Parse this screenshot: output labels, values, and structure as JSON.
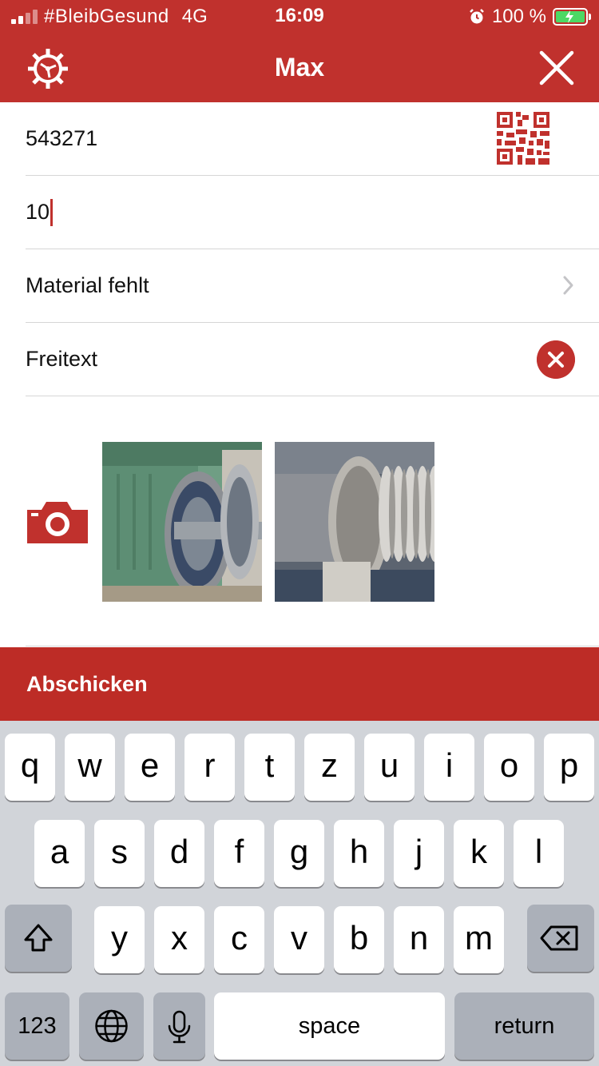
{
  "status_bar": {
    "carrier": "#BleibGesund",
    "network": "4G",
    "time": "16:09",
    "battery": "100 %"
  },
  "header": {
    "title": "Max"
  },
  "form": {
    "field_1_value": "543271",
    "field_2_value": "10",
    "field_3_value": "Material fehlt",
    "field_4_value": "Freitext"
  },
  "photos": {
    "count": 2
  },
  "submit_label": "Abschicken",
  "keyboard": {
    "row1": [
      "q",
      "w",
      "e",
      "r",
      "t",
      "z",
      "u",
      "i",
      "o",
      "p"
    ],
    "row2": [
      "a",
      "s",
      "d",
      "f",
      "g",
      "h",
      "j",
      "k",
      "l"
    ],
    "row3": [
      "y",
      "x",
      "c",
      "v",
      "b",
      "n",
      "m"
    ],
    "numbers_label": "123",
    "space_label": "space",
    "return_label": "return"
  },
  "colors": {
    "brand_red": "#c0312d",
    "keyboard_bg": "#d1d4d9"
  },
  "icons": [
    "gear-icon",
    "close-icon",
    "qr-code-icon",
    "chevron-right-icon",
    "clear-icon",
    "camera-icon",
    "shift-icon",
    "backspace-icon",
    "globe-icon",
    "microphone-icon",
    "alarm-icon",
    "battery-icon"
  ]
}
